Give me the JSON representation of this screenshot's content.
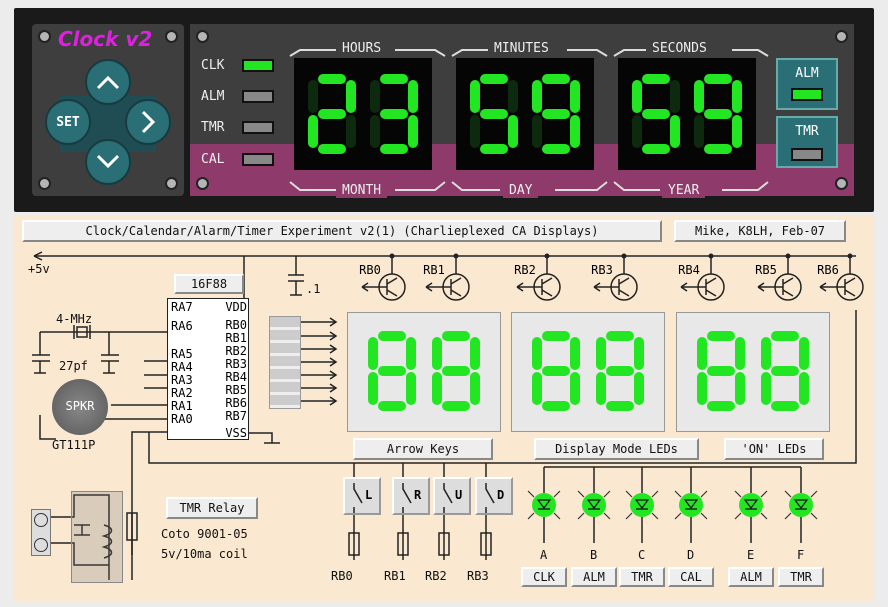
{
  "app": {
    "title": "Clock v2"
  },
  "keypad": {
    "set_label": "SET"
  },
  "status_leds": [
    {
      "label": "CLK",
      "on": true
    },
    {
      "label": "ALM",
      "on": false
    },
    {
      "label": "TMR",
      "on": false
    },
    {
      "label": "CAL",
      "on": false
    }
  ],
  "display": {
    "top_labels": [
      "HOURS",
      "MINUTES",
      "SECONDS"
    ],
    "bottom_labels": [
      "MONTH",
      "DAY",
      "YEAR"
    ],
    "digits": [
      "23",
      "59",
      "59"
    ]
  },
  "side_buttons": [
    {
      "label": "ALM",
      "on": true
    },
    {
      "label": "TMR",
      "on": false
    }
  ],
  "schematic": {
    "title": "Clock/Calendar/Alarm/Timer Experiment v2(1) (Charlieplexed CA Displays)",
    "author": "Mike, K8LH, Feb-07",
    "supply": "+5v",
    "cap": ".1",
    "chip": "16F88",
    "left_pins": [
      "RA7",
      "RA6",
      "RA5",
      "RA4",
      "RA3",
      "RA2",
      "RA1",
      "RA0"
    ],
    "right_pins": [
      "VDD",
      "RB0",
      "RB1",
      "RB2",
      "RB3",
      "RB4",
      "RB5",
      "RB6",
      "RB7",
      "VSS"
    ],
    "crystal": "4-MHz",
    "crystal_caps": "27pf",
    "speaker": "SPKR",
    "speaker_part": "GT111P",
    "relay_label": "TMR Relay",
    "relay_desc": [
      "Coto 9001-05",
      "5v/10ma coil"
    ],
    "transistors": [
      "RB0",
      "RB1",
      "RB2",
      "RB3",
      "RB4",
      "RB5",
      "RB6"
    ],
    "sections": {
      "arrow": "Arrow Keys",
      "mode": "Display Mode LEDs",
      "on": "'ON' LEDs"
    },
    "switches": [
      "L",
      "R",
      "U",
      "D"
    ],
    "switch_pins": [
      "RB0",
      "RB1",
      "RB2",
      "RB3"
    ],
    "led_letters": [
      "A",
      "B",
      "C",
      "D",
      "E",
      "F"
    ],
    "led_buttons": [
      "CLK",
      "ALM",
      "TMR",
      "CAL",
      "ALM",
      "TMR"
    ]
  },
  "colors": {
    "segment_on": "#22e622",
    "segment_off": "#0e2a0e",
    "panel": "#3e3e3e",
    "magenta": "#8e3a6a",
    "teal": "#2a6e76"
  }
}
